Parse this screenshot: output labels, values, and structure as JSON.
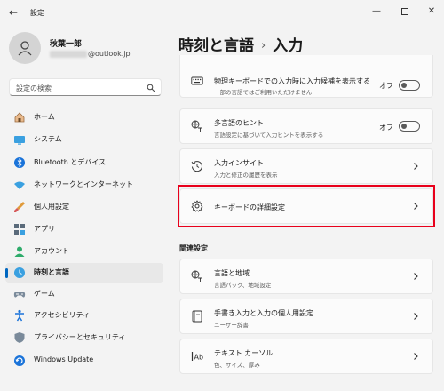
{
  "window": {
    "title": "設定"
  },
  "user": {
    "name": "秋葉一郎",
    "email_suffix": "@outlook.jp"
  },
  "search": {
    "placeholder": "設定の検索"
  },
  "sidebar": {
    "items": [
      {
        "label": "ホーム",
        "icon": "home-icon"
      },
      {
        "label": "システム",
        "icon": "system-icon"
      },
      {
        "label": "Bluetooth とデバイス",
        "icon": "bluetooth-icon"
      },
      {
        "label": "ネットワークとインターネット",
        "icon": "wifi-icon"
      },
      {
        "label": "個人用設定",
        "icon": "brush-icon"
      },
      {
        "label": "アプリ",
        "icon": "apps-icon"
      },
      {
        "label": "アカウント",
        "icon": "account-icon"
      },
      {
        "label": "時刻と言語",
        "icon": "time-language-icon",
        "selected": true
      },
      {
        "label": "ゲーム",
        "icon": "gamepad-icon"
      },
      {
        "label": "アクセシビリティ",
        "icon": "accessibility-icon"
      },
      {
        "label": "プライバシーとセキュリティ",
        "icon": "shield-icon"
      },
      {
        "label": "Windows Update",
        "icon": "update-icon"
      }
    ]
  },
  "header": {
    "breadcrumb_parent": "時刻と言語",
    "separator": "›",
    "title": "入力"
  },
  "cards": [
    {
      "title": "物理キーボードでの入力時に入力候補を表示する",
      "subtitle": "一部の言語ではご利用いただけません",
      "state": "オフ",
      "icon": "keyboard-icon"
    },
    {
      "title": "多言語のヒント",
      "subtitle": "言語設定に基づいて入力ヒントを表示する",
      "state": "オフ",
      "icon": "multilingual-icon"
    },
    {
      "title": "入力インサイト",
      "subtitle": "入力と修正の履歴を表示",
      "icon": "history-icon"
    },
    {
      "title": "キーボードの詳細設定",
      "subtitle": "",
      "icon": "gear-icon"
    }
  ],
  "related": {
    "heading": "関連設定",
    "cards": [
      {
        "title": "言語と地域",
        "subtitle": "言語パック、地域設定",
        "icon": "language-icon"
      },
      {
        "title": "手書き入力と入力の個人用設定",
        "subtitle": "ユーザー辞書",
        "icon": "book-icon"
      },
      {
        "title": "テキスト カーソル",
        "subtitle": "色、サイズ、厚み",
        "icon": "text-cursor-icon"
      }
    ]
  },
  "colors": {
    "accent": "#0067c0",
    "highlight": "#e8001b",
    "background": "#f3f3f3",
    "card": "#fbfbfb"
  }
}
